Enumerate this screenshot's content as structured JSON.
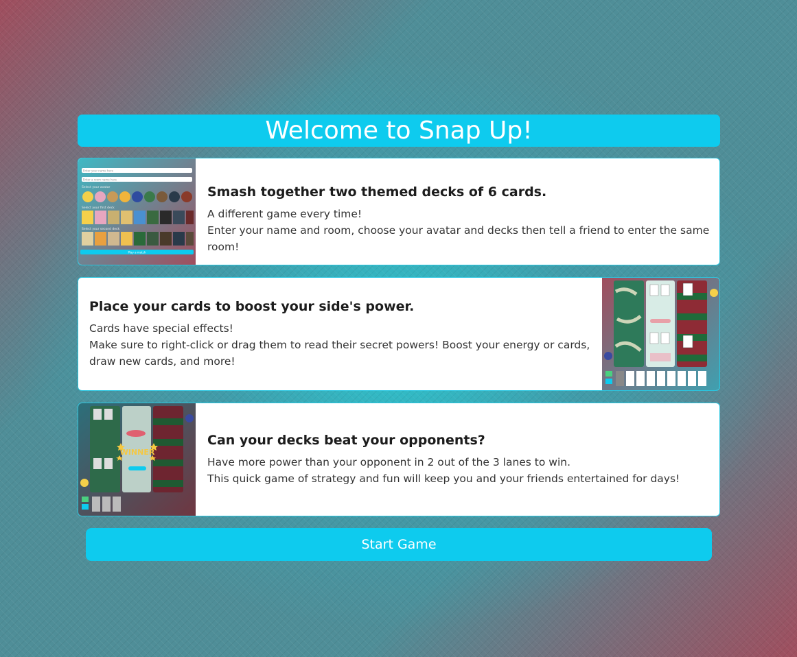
{
  "header": {
    "title": "Welcome to Snap Up!"
  },
  "cards": [
    {
      "heading": "Smash together two themed decks of 6 cards.",
      "lines": [
        "A different game every time!",
        "Enter your name and room, choose your avatar and decks then tell a friend to enter the same room!"
      ],
      "thumb": {
        "name_placeholder": "Enter your name here",
        "room_placeholder": "Enter a room name here",
        "avatar_label": "Select your avatar",
        "first_deck_label": "Select your first deck",
        "second_deck_label": "Select your second deck",
        "button_label": "Play a match"
      }
    },
    {
      "heading": "Place your cards to boost your side's power.",
      "lines": [
        "Cards have special effects!",
        "Make sure to right-click or drag them to read their secret powers! Boost your energy or cards, draw new cards, and more!"
      ]
    },
    {
      "heading": "Can your decks beat your opponents?",
      "lines": [
        "Have more power than your opponent in 2 out of the 3 lanes to win.",
        "This quick game of strategy and fun will keep you and your friends entertained for days!"
      ],
      "thumb": {
        "winner_label": "WINNER"
      }
    }
  ],
  "actions": {
    "start_label": "Start Game"
  },
  "colors": {
    "accent": "#0ecbee",
    "card_border": "#2ac6e0",
    "lane_red": "#8e2b35",
    "lane_green": "#1f6b3a"
  }
}
